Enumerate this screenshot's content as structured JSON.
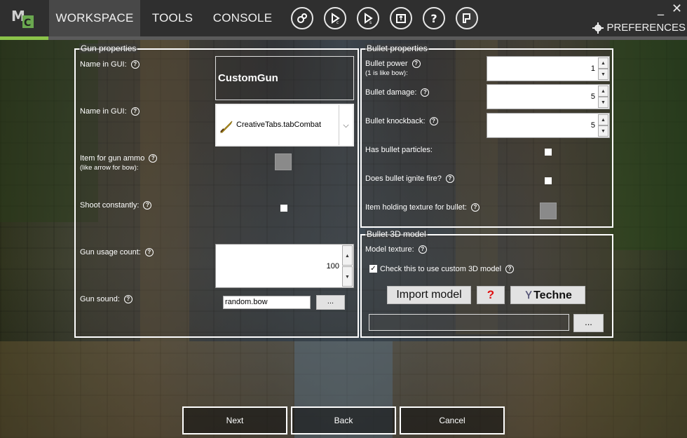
{
  "window": {
    "minimize": "_",
    "close": "✕"
  },
  "topbar": {
    "tabs": [
      {
        "label": "WORKSPACE"
      },
      {
        "label": "TOOLS"
      },
      {
        "label": "CONSOLE"
      }
    ],
    "icons": [
      "settings-gear-icon",
      "run-client-icon",
      "run-server-icon",
      "export-icon",
      "help-icon",
      "plugin-icon"
    ],
    "preferences_label": "PREFERENCES",
    "progress": 0.07,
    "accent": "#8bc34a"
  },
  "gun_properties": {
    "legend": "Gun properties",
    "name_label": "Name in GUI:",
    "name_value": "CustomGun",
    "tab_label": "Name in GUI:",
    "tab_value": "CreativeTabs.tabCombat",
    "ammo_label": "Item for gun ammo",
    "ammo_sub": "(like arrow for bow):",
    "shoot_label": "Shoot constantly:",
    "usage_label": "Gun usage count:",
    "usage_value": "100",
    "sound_label": "Gun sound:",
    "sound_value": "random.bow",
    "browse_label": "..."
  },
  "bullet_properties": {
    "legend": "Bullet properties",
    "power_label": "Bullet power",
    "power_sub": "(1 is like bow):",
    "power_value": "1",
    "damage_label": "Bullet damage:",
    "damage_value": "5",
    "knockback_label": "Bullet knockback:",
    "knockback_value": "5",
    "particles_label": "Has bullet particles:",
    "fire_label": "Does bullet ignite fire?",
    "texture_label": "Item holding texture for bullet:"
  },
  "bullet_model": {
    "legend": "Bullet 3D model",
    "texture_label": "Model texture:",
    "custom_check_label": "Check this to use custom 3D model",
    "import_label": "Import model",
    "question_label": "?",
    "techne_label": "Techne",
    "browse_label": "..."
  },
  "nav": {
    "next": "Next",
    "back": "Back",
    "cancel": "Cancel"
  }
}
